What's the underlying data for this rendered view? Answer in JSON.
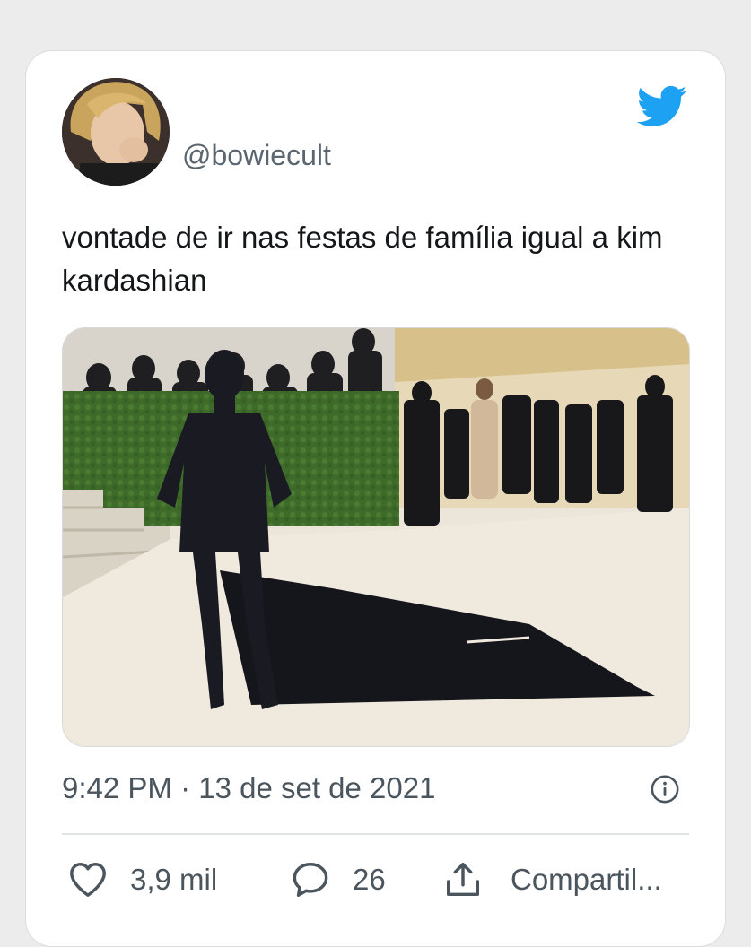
{
  "tweet": {
    "handle": "@bowiecult",
    "text": "vontade de ir nas festas de família igual a kim kardashian",
    "timestamp": "9:42 PM · 13 de set de 2021",
    "likes": "3,9 mil",
    "replies": "26",
    "share_label": "Compartil..."
  },
  "icons": {
    "brand": "twitter-bird-icon",
    "info": "info-icon",
    "like": "heart-icon",
    "reply": "speech-bubble-icon",
    "share": "share-icon"
  },
  "colors": {
    "twitter_blue": "#1da1f2",
    "text_primary": "#14171a",
    "text_secondary": "#4b555e"
  }
}
